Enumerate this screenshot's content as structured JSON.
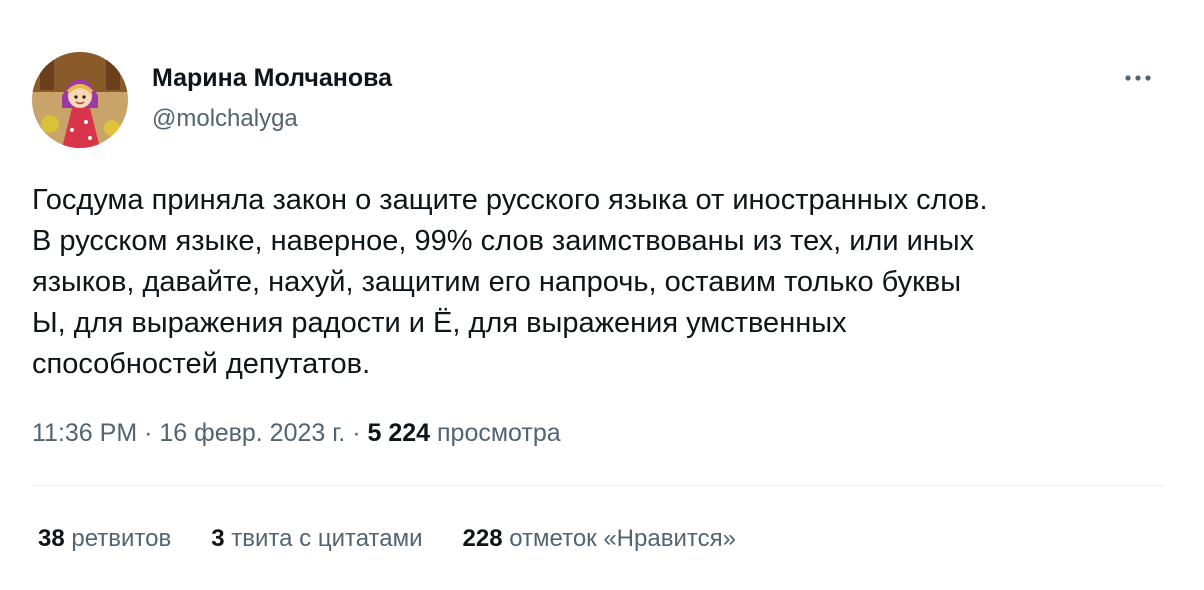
{
  "user": {
    "display_name": "Марина Молчанова",
    "handle": "@molchalyga"
  },
  "tweet": {
    "text": "Госдума приняла закон о защите русского языка от иностранных слов.\nВ русском языке, наверное, 99% слов заимствованы из тех, или иных\nязыков, давайте, нахуй, защитим его напрочь, оставим только буквы\nЫ, для выражения радости и Ё, для выражения умственных\nспособностей депутатов."
  },
  "meta": {
    "time": "11:36 PM",
    "separator": " · ",
    "date": "16 февр. 2023 г.",
    "views_count": "5 224",
    "views_label": "просмотра"
  },
  "stats": {
    "retweets_count": "38",
    "retweets_label": "ретвитов",
    "quotes_count": "3",
    "quotes_label": "твита с цитатами",
    "likes_count": "228",
    "likes_label": "отметок «Нравится»"
  },
  "icons": {
    "more": "more-horizontal-icon",
    "avatar": "user-avatar"
  },
  "colors": {
    "text_primary": "#0f1419",
    "text_secondary": "#536471",
    "divider": "#eff3f4"
  }
}
